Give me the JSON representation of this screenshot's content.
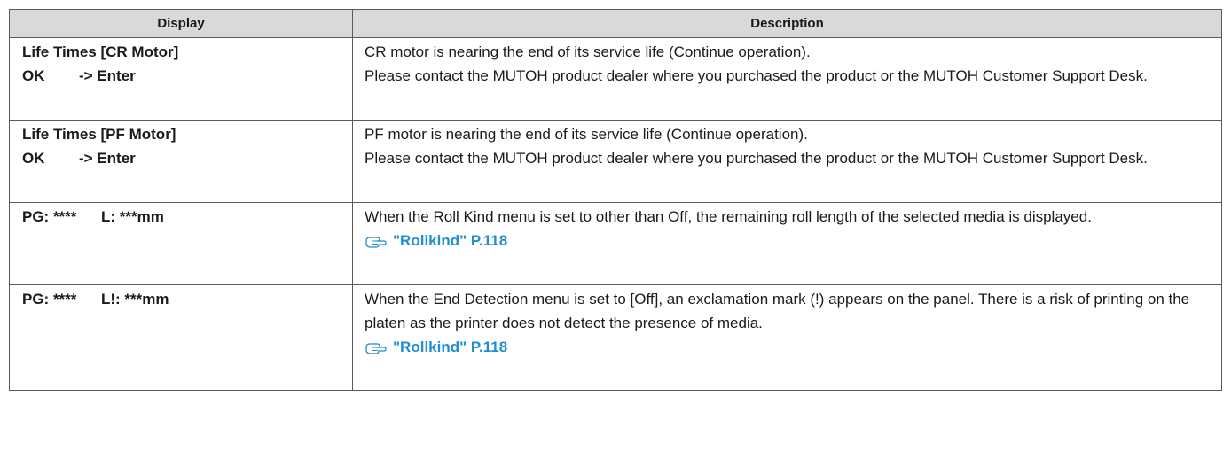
{
  "headers": {
    "display": "Display",
    "description": "Description"
  },
  "rows": [
    {
      "display_title": "Life Times [CR Motor]",
      "display_key": "OK",
      "display_action": "-> Enter",
      "desc_line1": "CR motor is nearing the end of its service life (Continue operation).",
      "desc_line2": "Please contact the MUTOH product dealer where you purchased the product or the MUTOH Customer Support Desk."
    },
    {
      "display_title": "Life Times [PF Motor]",
      "display_key": "OK",
      "display_action": "-> Enter",
      "desc_line1": "PF motor is nearing the end of its service life (Continue operation).",
      "desc_line2": "Please contact the MUTOH product dealer where you purchased the product or the MUTOH Customer Support Desk."
    },
    {
      "display_pg": "PG: ****",
      "display_len": "L: ***mm",
      "desc_text": "When the Roll Kind menu is set to other than Off, the remaining roll length of the selected media is displayed.",
      "ref_link": "\"Rollkind\" P.118"
    },
    {
      "display_pg": "PG: ****",
      "display_len": "L!: ***mm",
      "desc_text": "When the End Detection menu is set to [Off], an exclamation mark (!) appears on the panel. There is a risk of printing on the platen as the printer does not detect the presence of media.",
      "ref_link": "\"Rollkind\" P.118"
    }
  ],
  "colors": {
    "header_bg": "#d9d9d9",
    "link": "#1f8fd0",
    "border": "#5a5a5a"
  },
  "icons": {
    "reference": "pointing-hand-icon"
  }
}
